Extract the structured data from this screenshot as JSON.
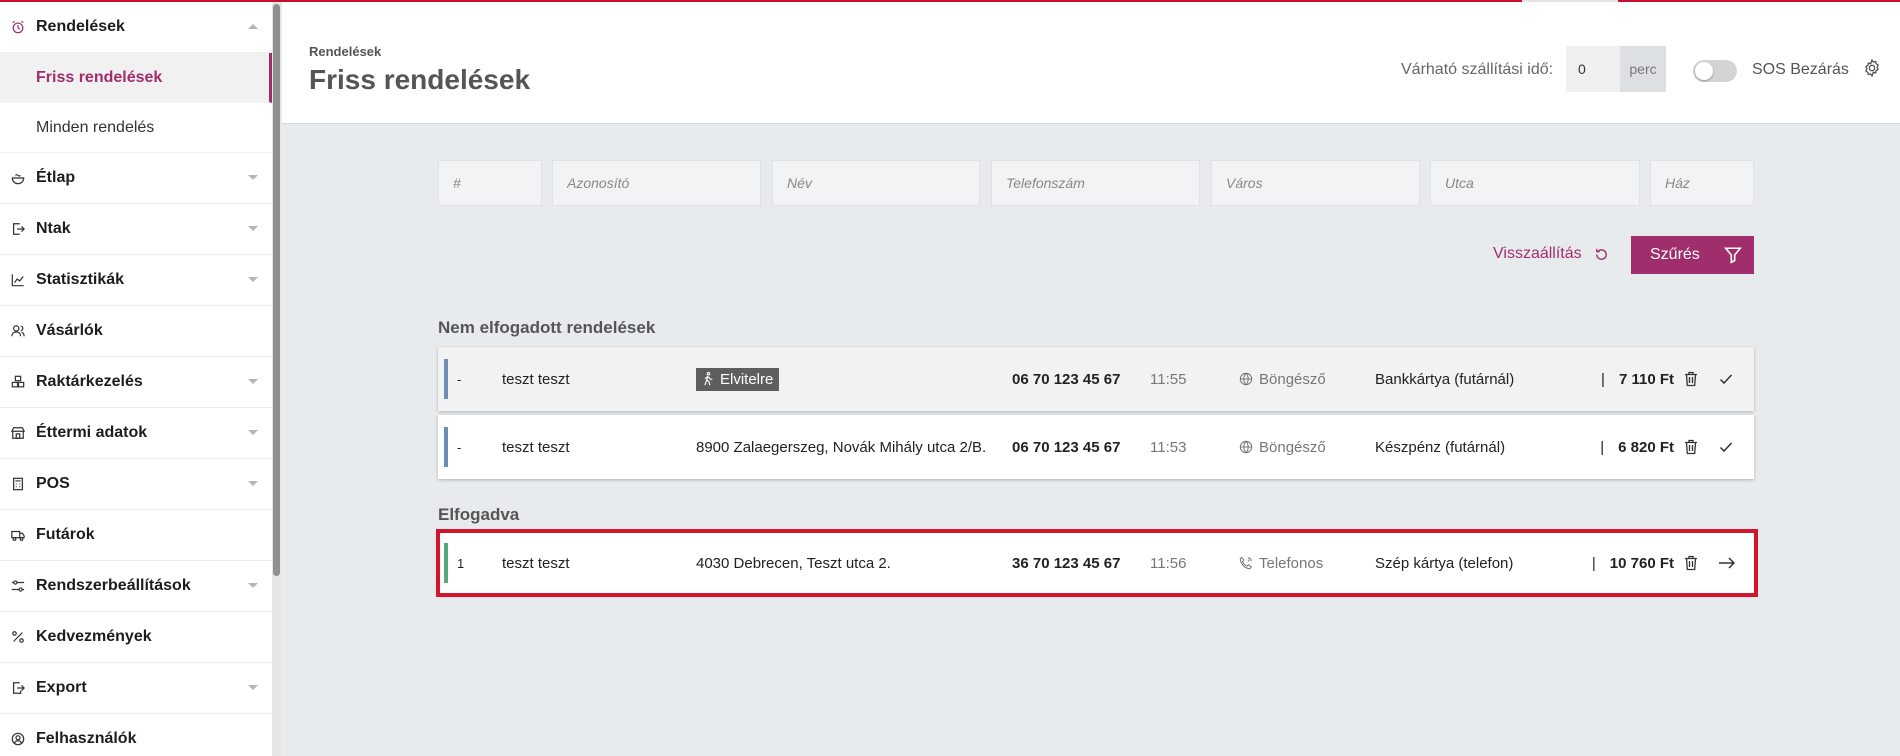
{
  "sidebar": {
    "orders_section": {
      "label": "Rendelések",
      "icon": "alarm-clock-icon"
    },
    "orders_sub": [
      {
        "label": "Friss rendelések",
        "active": true
      },
      {
        "label": "Minden rendelés",
        "active": false
      }
    ],
    "sections": [
      {
        "label": "Étlap",
        "icon": "bowl-icon",
        "expandable": true
      },
      {
        "label": "Ntak",
        "icon": "export-doc-icon",
        "expandable": true
      },
      {
        "label": "Statisztikák",
        "icon": "chart-line-icon",
        "expandable": true
      },
      {
        "label": "Vásárlók",
        "icon": "users-icon",
        "expandable": false
      },
      {
        "label": "Raktárkezelés",
        "icon": "boxes-icon",
        "expandable": true
      },
      {
        "label": "Éttermi adatok",
        "icon": "store-icon",
        "expandable": true
      },
      {
        "label": "POS",
        "icon": "calculator-icon",
        "expandable": true
      },
      {
        "label": "Futárok",
        "icon": "delivery-truck-icon",
        "expandable": false
      },
      {
        "label": "Rendszerbeállítások",
        "icon": "sliders-icon",
        "expandable": true
      },
      {
        "label": "Kedvezmények",
        "icon": "percent-icon",
        "expandable": false
      },
      {
        "label": "Export",
        "icon": "file-export-icon",
        "expandable": true
      },
      {
        "label": "Felhasználók",
        "icon": "user-circle-icon",
        "expandable": false
      }
    ]
  },
  "header": {
    "breadcrumb": "Rendelések",
    "title": "Friss rendelések",
    "delivery_time_label": "Várható szállítási idő:",
    "delivery_time_value": "0",
    "delivery_time_unit": "perc",
    "sos_label": "SOS Bezárás",
    "sos_enabled": false
  },
  "filters": {
    "placeholders": {
      "num": "#",
      "id": "Azonosító",
      "name": "Név",
      "phone": "Telefonszám",
      "city": "Város",
      "street": "Utca",
      "house": "Ház"
    },
    "reset_label": "Visszaállítás",
    "filter_label": "Szűrés"
  },
  "sections": {
    "not_accepted": "Nem elfogadott rendelések",
    "accepted": "Elfogadva"
  },
  "orders_not_accepted": [
    {
      "number": "-",
      "name": "teszt teszt",
      "address": "",
      "tag": "Elvitelre",
      "phone": "06 70 123 45 67",
      "time": "11:55",
      "source": "Böngésző",
      "payment": "Bankkártya (futárnál)",
      "amount": "7 110 Ft"
    },
    {
      "number": "-",
      "name": "teszt teszt",
      "address": "8900 Zalaegerszeg, Novák Mihály utca 2/B.",
      "tag": "",
      "phone": "06 70 123 45 67",
      "time": "11:53",
      "source": "Böngésző",
      "payment": "Készpénz (futárnál)",
      "amount": "6 820 Ft"
    }
  ],
  "orders_accepted": [
    {
      "number": "1",
      "name": "teszt teszt",
      "address": "4030 Debrecen, Teszt utca 2.",
      "phone": "36 70 123 45 67",
      "time": "11:56",
      "source": "Telefonos",
      "payment": "Szép kártya (telefon)",
      "amount": "10 760 Ft"
    }
  ],
  "amount_separator": "|",
  "colors": {
    "accent": "#a12e6c",
    "highlight": "#d3152b",
    "pending_bar": "#6b8fb3",
    "accepted_bar": "#5aa77a"
  }
}
